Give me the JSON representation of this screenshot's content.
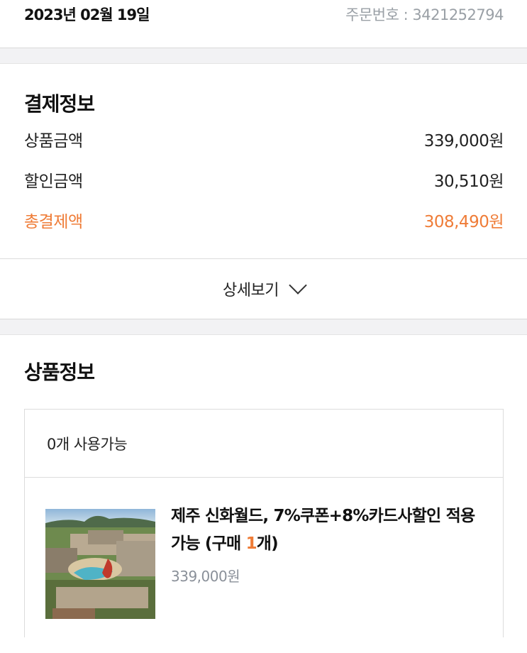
{
  "header": {
    "date": "2023년 02월 19일",
    "order_number": "주문번호 : 3421252794"
  },
  "payment": {
    "title": "결제정보",
    "rows": [
      {
        "label": "상품금액",
        "value": "339,000원"
      },
      {
        "label": "할인금액",
        "value": "30,510원"
      },
      {
        "label": "총결제액",
        "value": "308,490원"
      }
    ],
    "detail_label": "상세보기",
    "accent_color": "#ef7c37"
  },
  "product": {
    "title": "상품정보",
    "availability": "0개 사용가능",
    "item": {
      "name": "제주 신화월드, 7%쿠폰+8%카드사할인 적용 가능 (구매 ",
      "qty": "1",
      "qty_suffix": "개)",
      "price": "339,000원"
    }
  }
}
